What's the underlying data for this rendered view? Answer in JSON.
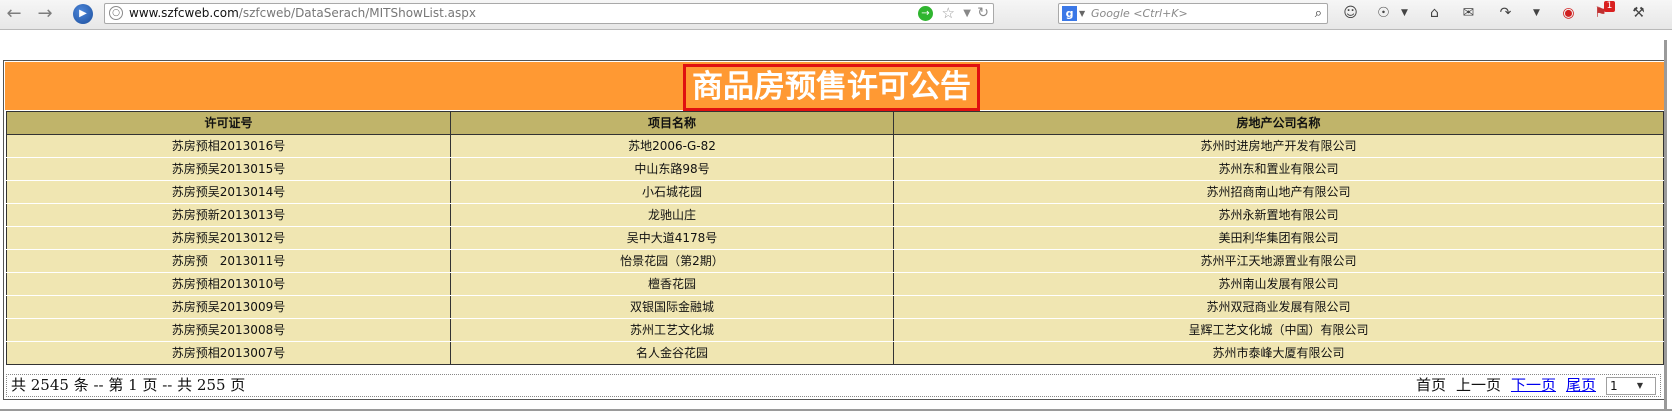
{
  "browser": {
    "url_domain": "www.szfcweb.com",
    "url_path": "/szfcweb/DataSerach/MITShowList.aspx",
    "search_placeholder": "Google <Ctrl+K>",
    "engine_letter": "g",
    "notification_count": "1"
  },
  "page": {
    "title": "商品房预售许可公告",
    "columns": [
      "许可证号",
      "项目名称",
      "房地产公司名称"
    ],
    "rows": [
      {
        "license": "苏房预相2013016号",
        "project": "苏地2006-G-82",
        "company": "苏州时进房地产开发有限公司"
      },
      {
        "license": "苏房预吴2013015号",
        "project": "中山东路98号",
        "company": "苏州东和置业有限公司"
      },
      {
        "license": "苏房预吴2013014号",
        "project": "小石城花园",
        "company": "苏州招商南山地产有限公司"
      },
      {
        "license": "苏房预新2013013号",
        "project": "龙驰山庄",
        "company": "苏州永新置地有限公司"
      },
      {
        "license": "苏房预吴2013012号",
        "project": "吴中大道4178号",
        "company": "美田利华集团有限公司"
      },
      {
        "license": "苏房预　2013011号",
        "project": "怡景花园（第2期）",
        "company": "苏州平江天地源置业有限公司"
      },
      {
        "license": "苏房预相2013010号",
        "project": "檀香花园",
        "company": "苏州南山发展有限公司"
      },
      {
        "license": "苏房预吴2013009号",
        "project": "双银国际金融城",
        "company": "苏州双冠商业发展有限公司"
      },
      {
        "license": "苏房预吴2013008号",
        "project": "苏州工艺文化城",
        "company": "呈辉工艺文化城（中国）有限公司"
      },
      {
        "license": "苏房预相2013007号",
        "project": "名人金谷花园",
        "company": "苏州市泰峰大厦有限公司"
      }
    ],
    "pager": {
      "summary": "共 2545 条 -- 第 1 页 -- 共 255 页",
      "first": "首页",
      "prev": "上一页",
      "next": "下一页",
      "last": "尾页",
      "current_page": "1"
    }
  },
  "colors": {
    "title_bg": "#ff9933",
    "title_border": "#e01010",
    "header_bg": "#c0b46a",
    "row_bg": "#f0e6b2",
    "link": "#0000ee"
  }
}
